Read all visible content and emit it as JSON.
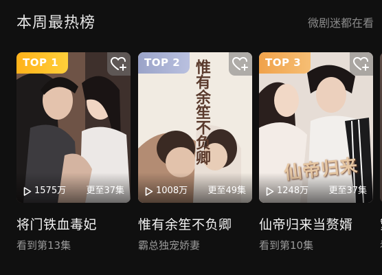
{
  "section": {
    "title": "本周最热榜",
    "subtitle": "微剧迷都在看"
  },
  "cards": [
    {
      "rank_label": "TOP 1",
      "play_count": "1575万",
      "episodes": "更至37集",
      "title": "将门铁血毒妃",
      "subtitle": "看到第13集",
      "rank_color": "#ffb21a"
    },
    {
      "rank_label": "TOP 2",
      "play_count": "1008万",
      "episodes": "更至49集",
      "title": "惟有余笙不负卿",
      "subtitle": "霸总独宠娇妻",
      "poster_art_text": "惟有余笙不负卿",
      "rank_color": "#9aa3c8"
    },
    {
      "rank_label": "TOP 3",
      "play_count": "1248万",
      "episodes": "更至37集",
      "title": "仙帝归来当赘婿",
      "subtitle": "看到第10集",
      "poster_art_text": "仙帝归来",
      "rank_color": "#f0a24a"
    },
    {
      "title": "繁",
      "subtitle": "看"
    }
  ],
  "icons": {
    "favorite": "heart-plus-icon",
    "play": "play-icon"
  }
}
